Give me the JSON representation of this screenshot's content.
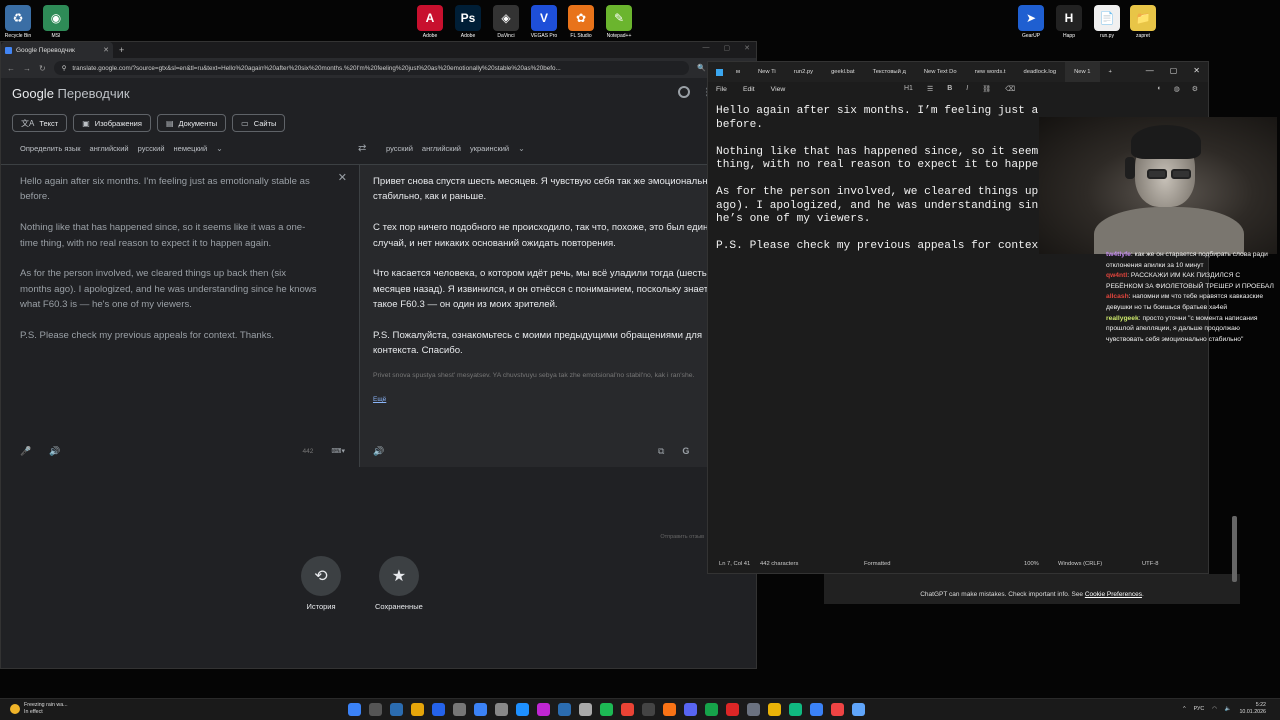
{
  "desktop": {
    "left_icons": [
      {
        "label": "Recycle Bin",
        "color": "#3a6ea5",
        "glyph": "♻"
      },
      {
        "label": "MSI",
        "color": "#2e8b57",
        "glyph": "◉"
      }
    ],
    "center_icons": [
      {
        "label": "Adobe",
        "color": "#c8102e",
        "glyph": "A"
      },
      {
        "label": "Adobe",
        "color": "#001e36",
        "glyph": "Ps"
      },
      {
        "label": "DaVinci",
        "color": "#333333",
        "glyph": "◈"
      },
      {
        "label": "VEGAS Pro",
        "color": "#1e4fd8",
        "glyph": "V"
      },
      {
        "label": "FL Studio",
        "color": "#e8731a",
        "glyph": "✿"
      },
      {
        "label": "Notepad++",
        "color": "#6bb52e",
        "glyph": "✎"
      }
    ],
    "right_icons": [
      {
        "label": "GearUP",
        "color": "#1f5fd1",
        "glyph": "➤"
      },
      {
        "label": "Happ",
        "color": "#222222",
        "glyph": "H"
      },
      {
        "label": "run.py",
        "color": "#f0f0f0",
        "glyph": "📄"
      },
      {
        "label": "zapret",
        "color": "#e8c547",
        "glyph": "📁"
      }
    ]
  },
  "browser": {
    "tab_title": "Google Переводчик",
    "url": "translate.google.com/?source=gtx&sl=en&tl=ru&text=Hello%20again%20after%20six%20months.%20I'm%20feeling%20just%20as%20emotionally%20stable%20as%20befo...",
    "logo_google": "Google",
    "logo_product": "Переводчик",
    "modes": [
      {
        "icon": "文A",
        "label": "Текст"
      },
      {
        "icon": "▣",
        "label": "Изображения"
      },
      {
        "icon": "▤",
        "label": "Документы"
      },
      {
        "icon": "▭",
        "label": "Сайты"
      }
    ],
    "source_langs": [
      "Определить язык",
      "английский",
      "русский",
      "немецкий"
    ],
    "target_langs": [
      "русский",
      "английский",
      "украинский"
    ],
    "source_paragraphs": [
      "Hello again after six months. I'm feeling just as emotionally stable as before.",
      "Nothing like that has happened since, so it seems like it was a one-time thing, with no real reason to expect it to happen again.",
      "As for the person involved, we cleared things up back then (six months ago). I apologized, and he was understanding since he knows what F60.3 is — he's one of my viewers.",
      "P.S. Please check my previous appeals for context. Thanks."
    ],
    "char_count": "442",
    "target_paragraphs": [
      "Привет снова спустя шесть месяцев. Я чувствую себя так же эмоционально стабильно, как и раньше.",
      "С тех пор ничего подобного не происходило, так что, похоже, это был единичный случай, и нет никаких оснований ожидать повторения.",
      "Что касается человека, о котором идёт речь, мы всё уладили тогда (шесть месяцев назад). Я извинился, и он отнёсся с пониманием, поскольку знает, что такое F60.3 — он один из моих зрителей.",
      "P.S. Пожалуйста, ознакомьтесь с моими предыдущими обращениями для контекста. Спасибо."
    ],
    "transliteration": "Privet snova spustya shest' mesyatsev. YA chuvstvuyu sebya tak zhe emotsional'no stabil'no, kak i ran'she.",
    "edit_link": "Ещё",
    "feedback": "Отправить отзыв",
    "history_label": "История",
    "saved_label": "Сохраненные"
  },
  "notepad": {
    "tabs": [
      "м",
      "New Ti",
      "run2.py",
      "geekl.bat",
      "Текстовый д",
      "New Text Do",
      "new words.t",
      "deadlock.log",
      "New 1"
    ],
    "menu": [
      "File",
      "Edit",
      "View"
    ],
    "heading": "H1",
    "lines": [
      "Hello again after six months. I’m feeling just as emotionally stable as",
      "before.",
      "",
      "Nothing like that has happened since, so it seems like it was a one-time",
      "thing, with no real reason to expect it to happen again.",
      "",
      "As for the person involved, we cleared things up back then (six months",
      "ago). I apologized, and he was understanding since he knows what F60.3 is —",
      "he’s one of my viewers.",
      "",
      "P.S. Please check my previous appeals for context. Thanks."
    ],
    "status": {
      "position": "Ln 7, Col 41",
      "chars": "442 characters",
      "mode": "Formatted",
      "zoom": "100%",
      "eol": "Windows (CRLF)",
      "encoding": "UTF-8"
    }
  },
  "chat": [
    {
      "user": "tw4tlyfe",
      "color": "#c58cf0",
      "text": "как же он старается подбирать слова ради отклонения апилки за 10 минут"
    },
    {
      "user": "qw4ntl",
      "color": "#e0443c",
      "text": "РАССКАЖИ ИМ КАК ПИЗДИЛСЯ С РЕБЁНКОМ ЗА ФИОЛЕТОВЫЙ ТРЕШЕР И ПРОЕБАЛ"
    },
    {
      "user": "allcash",
      "color": "#e0443c",
      "text": "напомни им что тебе нравятся кавказские девушки но ты боишься братьев ха4ей"
    },
    {
      "user": "reallygeek",
      "color": "#cde86b",
      "text": "просто уточни \"с момента написания прошлой апелляции, я дальше продолжаю чувствовать себя эмоционально стабильно\""
    }
  ],
  "chatgpt_note": {
    "prefix": "ChatGPT can make mistakes. Check important info. See",
    "link": "Cookie Preferences",
    "suffix": "."
  },
  "taskbar": {
    "weather_title": "Freezing rain wa...",
    "weather_sub": "In effect",
    "lang": "РУС",
    "time": "5:22",
    "date": "10.01.2026",
    "icons": [
      "#3b82f6",
      "#555",
      "#2b6cb0",
      "#e5a50a",
      "#2563eb",
      "#777",
      "#3b82f6",
      "#888",
      "#1e90ff",
      "#c026d3",
      "#2b6cb0",
      "#aaa",
      "#1db954",
      "#ea4335",
      "#444",
      "#f97316",
      "#5865f2",
      "#16a34a",
      "#dc2626",
      "#6b7280",
      "#eab308",
      "#10b981",
      "#3b82f6",
      "#ef4444",
      "#60a5fa"
    ]
  }
}
